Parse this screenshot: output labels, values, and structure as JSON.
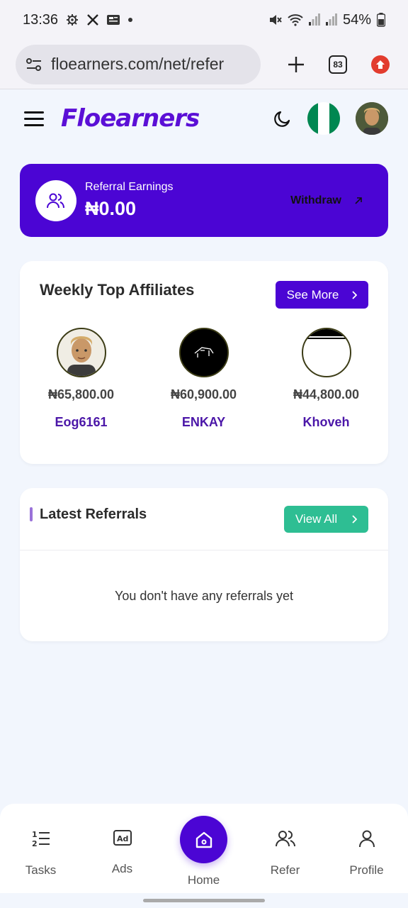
{
  "status_bar": {
    "time": "13:36",
    "battery": "54%",
    "icons": [
      "settings-gear-icon",
      "x-logo-icon",
      "news-icon",
      "dot-icon",
      "mute-icon",
      "wifi-icon",
      "signal-icon",
      "signal-icon",
      "battery-icon"
    ]
  },
  "browser": {
    "url": "floearners.com/net/refer",
    "tab_count": "83",
    "icons": [
      "site-settings-icon",
      "new-tab-plus-icon",
      "tabs-icon",
      "extension-icon"
    ]
  },
  "header": {
    "logo": "Floearners",
    "icons": [
      "hamburger-menu-icon",
      "moon-icon",
      "nigeria-flag-icon",
      "avatar"
    ],
    "flag_colors": [
      "#008751",
      "#ffffff",
      "#008751"
    ]
  },
  "earnings": {
    "label": "Referral Earnings",
    "amount": "₦0.00",
    "withdraw_label": "Withdraw",
    "accent": "#4b05d4"
  },
  "affiliates": {
    "title": "Weekly Top Affiliates",
    "see_more": "See More",
    "items": [
      {
        "amount": "₦65,800.00",
        "name": "Eog6161"
      },
      {
        "amount": "₦60,900.00",
        "name": "ENKAY"
      },
      {
        "amount": "₦44,800.00",
        "name": "Khoveh"
      }
    ]
  },
  "referrals": {
    "title": "Latest Referrals",
    "view_all": "View All",
    "empty_text": "You don't have any referrals yet",
    "button_color": "#2ebe93"
  },
  "bottom_nav": {
    "items": [
      {
        "label": "Tasks",
        "icon": "list-numbered-icon"
      },
      {
        "label": "Ads",
        "icon": "ad-icon"
      },
      {
        "label": "Home",
        "icon": "home-icon"
      },
      {
        "label": "Refer",
        "icon": "users-icon"
      },
      {
        "label": "Profile",
        "icon": "user-icon"
      }
    ]
  }
}
